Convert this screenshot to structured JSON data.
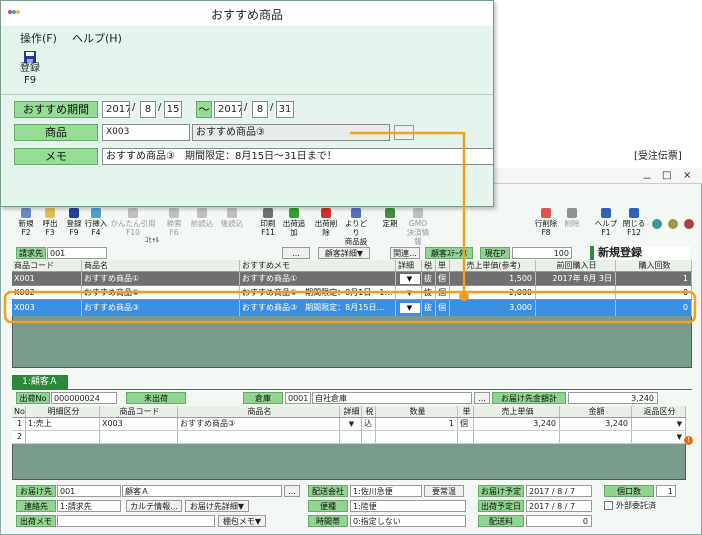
{
  "front": {
    "title": "おすすめ商品",
    "menu": [
      "操作(F)",
      "ヘルプ(H)"
    ],
    "save_button": {
      "label": "登録",
      "key": "F9"
    },
    "period_label": "おすすめ期間",
    "from": {
      "year": "2017",
      "month": "8",
      "day": "15"
    },
    "tilde": "～",
    "to": {
      "year": "2017",
      "month": "8",
      "day": "31"
    },
    "slash": "/",
    "product_label": "商品",
    "product_code": "X003",
    "product_name": "おすすめ商品③",
    "lookup": "...",
    "memo_label": "メモ",
    "memo_value": "おすすめ商品③　期間限定：8月15日～31日まで！"
  },
  "back": {
    "title": "[受注伝票]",
    "toolbar": [
      {
        "label": "新規",
        "key": "F2",
        "enabled": true,
        "color": "#6a8ad0"
      },
      {
        "label": "呼出",
        "key": "F3",
        "enabled": true,
        "color": "#e0c050"
      },
      {
        "label": "登録",
        "key": "F9",
        "enabled": true,
        "color": "#2040a0"
      },
      {
        "label": "行挿入",
        "key": "F4",
        "enabled": true,
        "color": "#50a0d0"
      },
      {
        "label": "かんたん引用",
        "key": "F10",
        "enabled": false,
        "color": "#c0c0c0"
      },
      {
        "label": "検索",
        "key": "F6",
        "enabled": false,
        "color": "#c0c0c0"
      },
      {
        "label": "前読込",
        "key": "",
        "enabled": false,
        "color": "#c0c0c0"
      },
      {
        "label": "後読込",
        "key": "",
        "enabled": false,
        "color": "#c0c0c0"
      },
      {
        "label": "印刷",
        "key": "F11",
        "enabled": true,
        "color": "#707070"
      },
      {
        "label": "出荷追加",
        "key": "",
        "enabled": true,
        "color": "#30a030"
      },
      {
        "label": "出荷削除",
        "key": "",
        "enabled": true,
        "color": "#d03030"
      },
      {
        "label": "よりどり\n商品設定",
        "key": "",
        "enabled": true,
        "color": "#5070c0"
      },
      {
        "label": "定期",
        "key": "",
        "enabled": true,
        "color": "#409040"
      },
      {
        "label": "GMO\n決済情報",
        "key": "",
        "enabled": false,
        "color": "#c0c0c0"
      }
    ],
    "toolbar_right": [
      {
        "label": "行削除",
        "key": "F8",
        "enabled": true,
        "color": "#e05050"
      },
      {
        "label": "削除",
        "key": "",
        "enabled": false,
        "color": "#909090"
      },
      {
        "label": "ヘルプ",
        "key": "F1",
        "enabled": true,
        "color": "#3060c0"
      },
      {
        "label": "閉じる",
        "key": "F12",
        "enabled": true,
        "color": "#3060c0"
      }
    ],
    "circles": [
      "#3a9a9a",
      "#9a9a40",
      "#b04040"
    ],
    "peek_label": "ｺﾋｬﾙ",
    "billto_label": "請求先",
    "billto_value": "001",
    "customer_detail": "顧客詳細▼",
    "related": "関連...",
    "customer_status": "顧客ｽﾃｰﾀｽ",
    "current_label": "現在P",
    "current_value": "100",
    "new_badge": "新規登録",
    "upper_headers": [
      "商品コード",
      "商品名",
      "おすすめメモ",
      "詳細",
      "税",
      "単位",
      "売上単価(参考)",
      "前回購入日",
      "購入回数"
    ],
    "upper_rows": [
      {
        "code": "X001",
        "name": "おすすめ商品①",
        "memo": "おすすめ商品①",
        "tax": "抜",
        "unit": "個",
        "price": "1,500",
        "last": "2017年 8月 3日",
        "count": "1",
        "style": "gray"
      },
      {
        "code": "X002",
        "name": "おすすめ商品②",
        "memo": "おすすめ商品②　期間限定：8月1日～1…",
        "tax": "抜",
        "unit": "個",
        "price": "2,000",
        "last": "",
        "count": "0",
        "style": "white"
      },
      {
        "code": "X003",
        "name": "おすすめ商品③",
        "memo": "おすすめ商品③　期間限定：8月15日…",
        "tax": "抜",
        "unit": "個",
        "price": "3,000",
        "last": "",
        "count": "0",
        "style": "blue"
      }
    ],
    "tab_label": "1:顧客Ａ",
    "ship_no_label": "出荷No",
    "ship_no": "000000024",
    "ship_status": "未出荷",
    "warehouse_label": "倉庫",
    "warehouse_code": "0001",
    "warehouse_name": "自社倉庫",
    "dest_total_label": "お届け先金額計",
    "dest_total": "3,240",
    "lower_headers": [
      "No",
      "明細区分",
      "商品コード",
      "商品名",
      "詳細",
      "税",
      "数量",
      "単位",
      "売上単価",
      "金額",
      "返品区分"
    ],
    "lower_rows": [
      {
        "no": "1",
        "kind": "1:売上",
        "code": "X003",
        "name": "おすすめ商品③",
        "tax": "込",
        "qty": "1",
        "unit": "個",
        "price": "3,240",
        "amount": "3,240"
      },
      {
        "no": "2",
        "kind": "",
        "code": "",
        "name": "",
        "tax": "",
        "qty": "",
        "unit": "",
        "price": "",
        "amount": ""
      }
    ],
    "bottom": {
      "dest_label": "お届け先",
      "dest_code": "001",
      "dest_name": "顧客Ａ",
      "carrier_label": "配送会社",
      "carrier_value": "1:佐川急便",
      "temp_label": "要常温",
      "delivery_date_label": "お届け予定",
      "delivery_date": "2017 / 8 / 7",
      "packages_label": "個口数",
      "packages": "1",
      "contact_label": "連絡先",
      "contact_value": "1:請求先",
      "karte": "カルテ情報...",
      "dest_detail": "お届け先詳細▼",
      "service_label": "便種",
      "service_value": "1:陸便",
      "ship_date_label": "出荷予定日",
      "ship_date": "2017 / 8 / 7",
      "outside_label": "外部委託済",
      "ship_memo_label": "出荷メモ",
      "shelf_memo": "棚包メモ▼",
      "time_label": "時間帯",
      "time_value": "0:指定しない",
      "fee_label": "配送料",
      "fee": "0"
    }
  },
  "colors": {
    "highlight": "#f0a020",
    "selected_row": "#3b8fe0",
    "label_green": "#8fd48f"
  }
}
